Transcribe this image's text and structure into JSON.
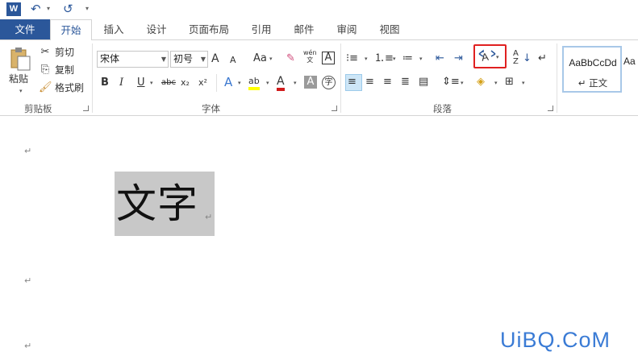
{
  "titlebar": {
    "app_logo": "W",
    "undo_icon": "↶",
    "redo_icon": "↺",
    "customize_icon": "▾"
  },
  "tabs": [
    {
      "label": "文件"
    },
    {
      "label": "开始"
    },
    {
      "label": "插入"
    },
    {
      "label": "设计"
    },
    {
      "label": "页面布局"
    },
    {
      "label": "引用"
    },
    {
      "label": "邮件"
    },
    {
      "label": "审阅"
    },
    {
      "label": "视图"
    }
  ],
  "clipboard": {
    "paste_label": "粘贴",
    "cut_label": "剪切",
    "copy_label": "复制",
    "format_painter_label": "格式刷",
    "group_label": "剪贴板"
  },
  "font": {
    "font_name": "宋体",
    "font_size": "初号",
    "grow": "A",
    "shrink": "A",
    "change_case": "Aa",
    "phonetic": "wén\n文",
    "char_border": "A",
    "bold": "B",
    "italic": "I",
    "underline": "U",
    "strike": "abc",
    "subscript": "x₂",
    "superscript": "x²",
    "text_effects": "A",
    "highlight": "ab",
    "font_color": "A",
    "char_shading": "A",
    "enclose": "字",
    "group_label": "字体"
  },
  "paragraph": {
    "group_label": "段落",
    "sort": "A↓Z"
  },
  "styles": {
    "normal_sample": "AaBbCcDd",
    "normal_name": "↵ 正文",
    "next_sample": "Aa"
  },
  "document": {
    "content_text": "文字",
    "para_mark": "↵"
  },
  "watermark": "UiBQ.CoM",
  "colors": {
    "accent": "#2b579a",
    "highlight_frame": "#e02020",
    "selection": "#c8c8c8",
    "watermark": "#3a7bd5"
  }
}
